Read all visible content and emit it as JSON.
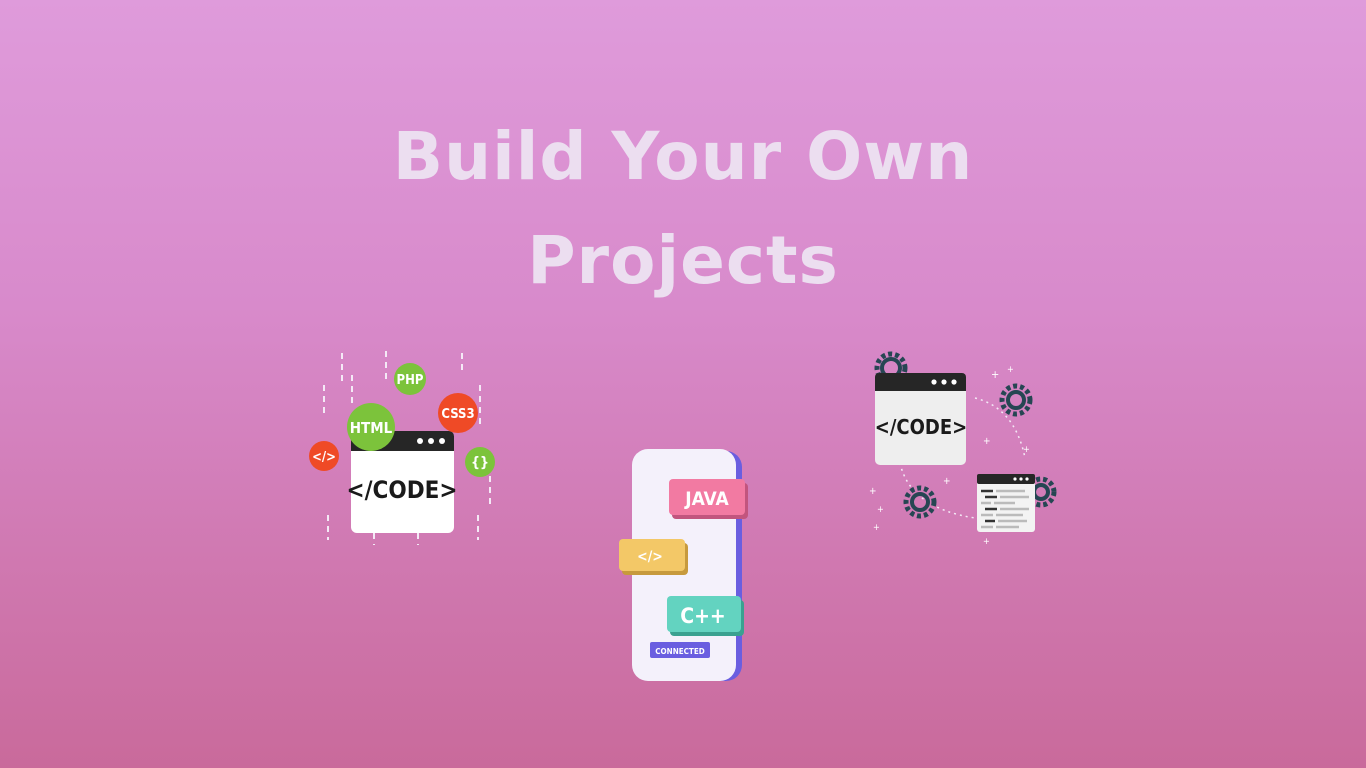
{
  "title": {
    "line1": "Build Your Own",
    "line2": "Projects"
  },
  "left_illustration": {
    "code_label": "</CODE>",
    "badges": [
      "PHP",
      "HTML",
      "CSS3",
      "</>",
      "{}"
    ]
  },
  "phone_illustration": {
    "tags": [
      "JAVA",
      "</>",
      "C++"
    ],
    "status": "CONNECTED"
  },
  "right_illustration": {
    "code_label": "</CODE>"
  },
  "colors": {
    "title": "#ecdef0",
    "green": "#7cc33b",
    "red": "#ef4a26",
    "pink_tag": "#f27aa2",
    "yellow_tag": "#f3c867",
    "teal_tag": "#63d3c0",
    "purple": "#6a5ee0"
  }
}
